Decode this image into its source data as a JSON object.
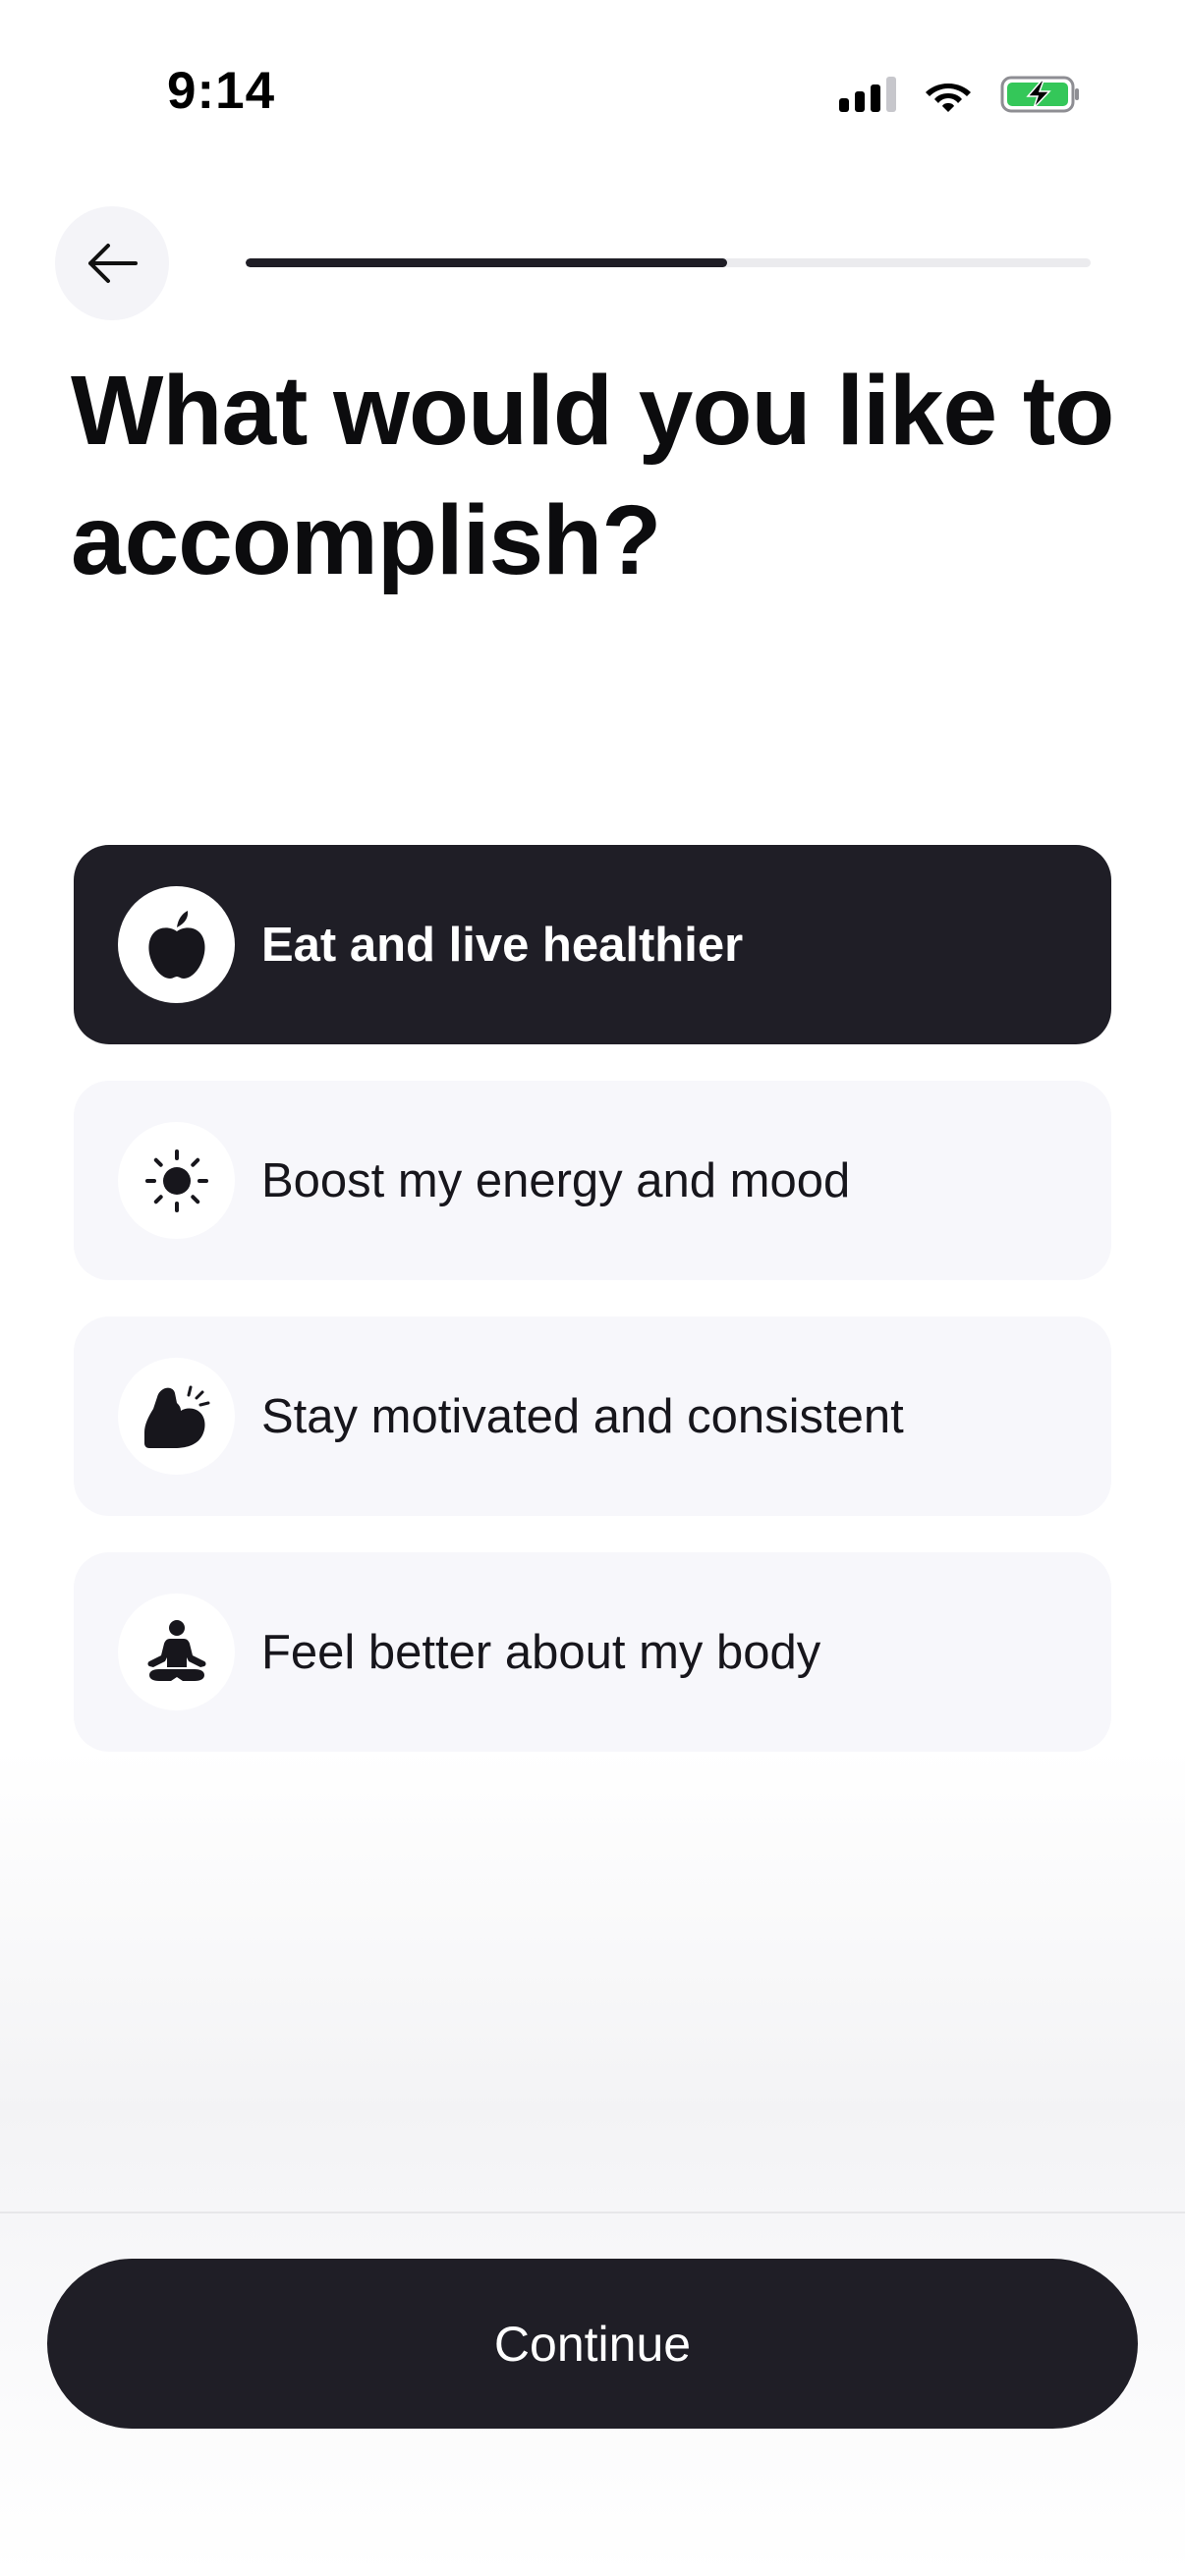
{
  "status_bar": {
    "time": "9:14",
    "icons": [
      "cellular-signal-icon",
      "wifi-icon",
      "battery-charging-icon"
    ],
    "battery_color": "#34c759"
  },
  "header": {
    "back_icon": "arrow-left-icon",
    "progress_fraction": 0.57
  },
  "title": "What would you like to accomplish?",
  "options": [
    {
      "label": "Eat and live healthier",
      "icon": "apple-icon",
      "selected": true
    },
    {
      "label": "Boost my energy and mood",
      "icon": "sun-icon",
      "selected": false
    },
    {
      "label": "Stay motivated and consistent",
      "icon": "flexed-bicep-icon",
      "selected": false
    },
    {
      "label": "Feel better about my body",
      "icon": "meditation-icon",
      "selected": false
    }
  ],
  "footer": {
    "continue_label": "Continue"
  },
  "colors": {
    "primary": "#1f1e26",
    "option_background": "#f7f7fb",
    "progress_track": "#ebebee"
  }
}
